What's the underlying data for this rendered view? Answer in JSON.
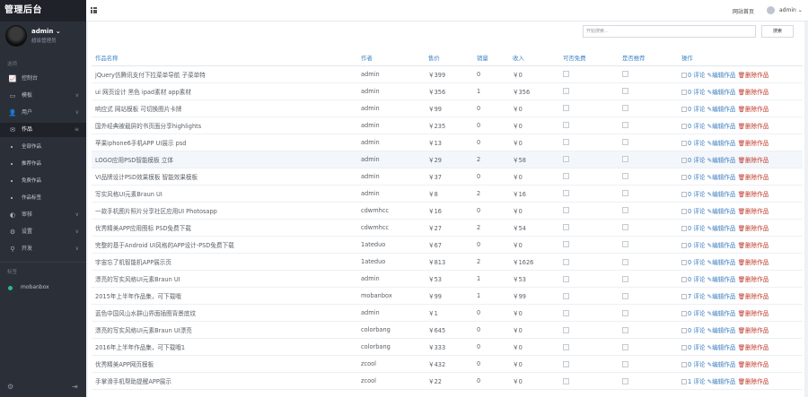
{
  "app": {
    "brand": "管理后台"
  },
  "user": {
    "name": "admin ⌄",
    "role": "超级管理员"
  },
  "sidebar": {
    "section1_label": "选项",
    "items": [
      {
        "icon": "📈",
        "label": "控制台",
        "badge": ""
      },
      {
        "icon": "▭",
        "label": "模板",
        "badge": "∨"
      },
      {
        "icon": "👤",
        "label": "用户",
        "badge": "∨"
      },
      {
        "icon": "✉",
        "label": "作品",
        "badge": "≡"
      }
    ],
    "subitems": [
      "全部作品",
      "推荐作品",
      "免费作品",
      "作品标签"
    ],
    "items2": [
      {
        "icon": "◐",
        "label": "审核",
        "badge": "∨"
      },
      {
        "icon": "⚙",
        "label": "设置",
        "badge": "∨"
      },
      {
        "icon": "⚲",
        "label": "开发",
        "badge": "∨"
      }
    ],
    "section2_label": "标签",
    "tags": [
      "mobanbox"
    ]
  },
  "topbar": {
    "link1": "网站首页",
    "user": "admin ⌄"
  },
  "search": {
    "placeholder": "开始搜索...",
    "button": "搜索"
  },
  "table": {
    "headers": [
      "作品名称",
      "作者",
      "售价",
      "销量",
      "收入",
      "可否免费",
      "是否推荐",
      "操作"
    ],
    "rows": [
      {
        "name": "jQuery仿腾讯支付下拉菜单导航 子菜单特",
        "author": "admin",
        "price": "￥399",
        "sales": "0",
        "income": "￥0",
        "comments": "0"
      },
      {
        "name": "ui 网页设计 黑色 ipad素材 app素材",
        "author": "admin",
        "price": "￥356",
        "sales": "1",
        "income": "￥356",
        "comments": "0"
      },
      {
        "name": "响应式 网站模板 可切换图片卡牌",
        "author": "admin",
        "price": "￥99",
        "sales": "0",
        "income": "￥0",
        "comments": "0"
      },
      {
        "name": "国外经典被截屏的书页面分享highlights",
        "author": "admin",
        "price": "￥235",
        "sales": "0",
        "income": "￥0",
        "comments": "0"
      },
      {
        "name": "苹果iphone6手机APP UI展示 psd",
        "author": "admin",
        "price": "￥13",
        "sales": "0",
        "income": "￥0",
        "comments": "0"
      },
      {
        "name": "LOGO应用PSD智能模板 立体",
        "author": "admin",
        "price": "￥29",
        "sales": "2",
        "income": "￥58",
        "comments": "0"
      },
      {
        "name": "VI品牌设计PSD效果模板 智能效果模板",
        "author": "admin",
        "price": "￥37",
        "sales": "0",
        "income": "￥0",
        "comments": "0"
      },
      {
        "name": "写实风格UI元素Braun UI",
        "author": "admin",
        "price": "￥8",
        "sales": "2",
        "income": "￥16",
        "comments": "0"
      },
      {
        "name": "一款手机图片照片分享社区应用UI Photosapp",
        "author": "cdwmhcc",
        "price": "￥16",
        "sales": "0",
        "income": "￥0",
        "comments": "0"
      },
      {
        "name": "优秀精美APP应用图标 PSD免费下载",
        "author": "cdwmhcc",
        "price": "￥27",
        "sales": "2",
        "income": "￥54",
        "comments": "0"
      },
      {
        "name": "完整的基于Android UI风格的APP设计-PSD免费下载",
        "author": "1ateduo",
        "price": "￥67",
        "sales": "0",
        "income": "￥0",
        "comments": "0"
      },
      {
        "name": "宇宙忘了机智能机APP展示页",
        "author": "1ateduo",
        "price": "￥813",
        "sales": "2",
        "income": "￥1626",
        "comments": "0"
      },
      {
        "name": "漂亮的写实风格UI元素Braun UI",
        "author": "admin",
        "price": "￥53",
        "sales": "1",
        "income": "￥53",
        "comments": "0"
      },
      {
        "name": "2015年上半年作品集，可下载哦",
        "author": "mobanbox",
        "price": "￥99",
        "sales": "1",
        "income": "￥99",
        "comments": "7"
      },
      {
        "name": "蓝色中国风山水群山界面插图背景底纹",
        "author": "admin",
        "price": "￥1",
        "sales": "0",
        "income": "￥0",
        "comments": "0"
      },
      {
        "name": "漂亮的写实风格UI元素Braun UI漂亮",
        "author": "colorbang",
        "price": "￥645",
        "sales": "0",
        "income": "￥0",
        "comments": "0"
      },
      {
        "name": "2016年上半年作品集，可下载哦1",
        "author": "colorbang",
        "price": "￥333",
        "sales": "0",
        "income": "￥0",
        "comments": "0"
      },
      {
        "name": "优秀精美APP网页模板",
        "author": "zcool",
        "price": "￥432",
        "sales": "0",
        "income": "￥0",
        "comments": "0"
      },
      {
        "name": "手掌滑手机帮助提醒APP展示",
        "author": "zcool",
        "price": "￥22",
        "sales": "0",
        "income": "￥0",
        "comments": "1"
      }
    ],
    "ops": {
      "comment_suffix": "评论",
      "edit": "编辑作品",
      "delete": "删除作品"
    }
  },
  "colors": {
    "sidebar_bg": "#2b3038",
    "header_text": "#3d84c6",
    "accent_link": "#3d7fc0",
    "delete": "#c0392b",
    "tag_dot": "#2bbb8a"
  }
}
